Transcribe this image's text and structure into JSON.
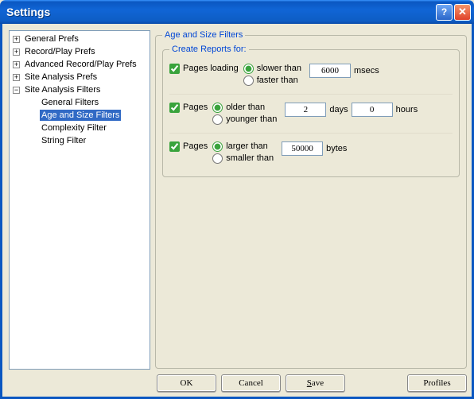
{
  "title": "Settings",
  "tree": {
    "items": [
      {
        "label": "General Prefs",
        "exp": "+"
      },
      {
        "label": "Record/Play Prefs",
        "exp": "+"
      },
      {
        "label": "Advanced Record/Play Prefs",
        "exp": "+"
      },
      {
        "label": "Site Analysis Prefs",
        "exp": "+"
      },
      {
        "label": "Site Analysis Filters",
        "exp": "−"
      }
    ],
    "children": [
      {
        "label": "General Filters"
      },
      {
        "label": "Age and Size Filters",
        "selected": true
      },
      {
        "label": "Complexity Filter"
      },
      {
        "label": "String Filter"
      }
    ]
  },
  "panel": {
    "title": "Age and Size Filters",
    "groupTitle": "Create Reports for:",
    "rowLoad": {
      "check": "Pages loading",
      "r1": "slower than",
      "r2": "faster than",
      "val": "6000",
      "unit": "msecs"
    },
    "rowAge": {
      "check": "Pages",
      "r1": "older than",
      "r2": "younger than",
      "daysVal": "2",
      "daysUnit": "days",
      "hoursVal": "0",
      "hoursUnit": "hours"
    },
    "rowSize": {
      "check": "Pages",
      "r1": "larger than",
      "r2": "smaller than",
      "val": "50000",
      "unit": "bytes"
    }
  },
  "buttons": {
    "ok": "OK",
    "cancel": "Cancel",
    "save_pre": "",
    "save_mn": "S",
    "save_post": "ave",
    "profiles": "Profiles"
  }
}
